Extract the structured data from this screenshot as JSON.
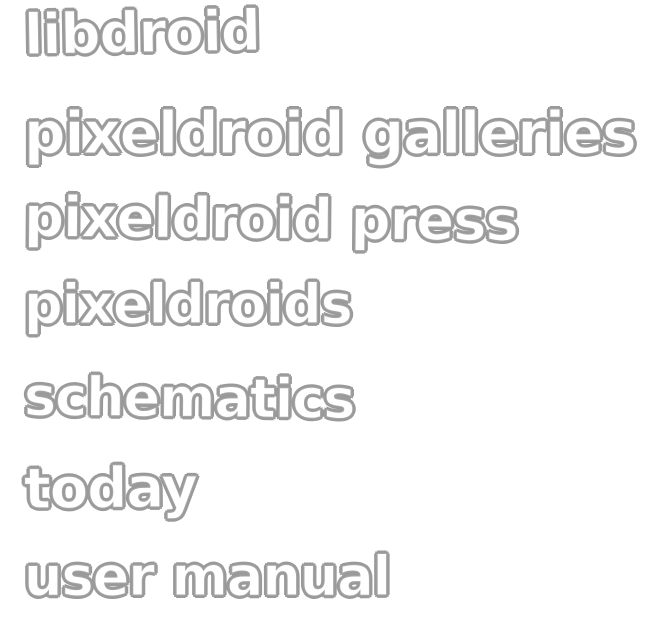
{
  "nav": {
    "items": [
      {
        "label": "libdroid"
      },
      {
        "label": "pixeldroid galleries"
      },
      {
        "label": "pixeldroid press"
      },
      {
        "label": "pixeldroids"
      },
      {
        "label": "schematics"
      },
      {
        "label": "today"
      },
      {
        "label": "user manual"
      }
    ]
  },
  "colors": {
    "background": "#ffffff",
    "text_fill": "#ffffff",
    "text_outline": "#9a9a9a"
  }
}
